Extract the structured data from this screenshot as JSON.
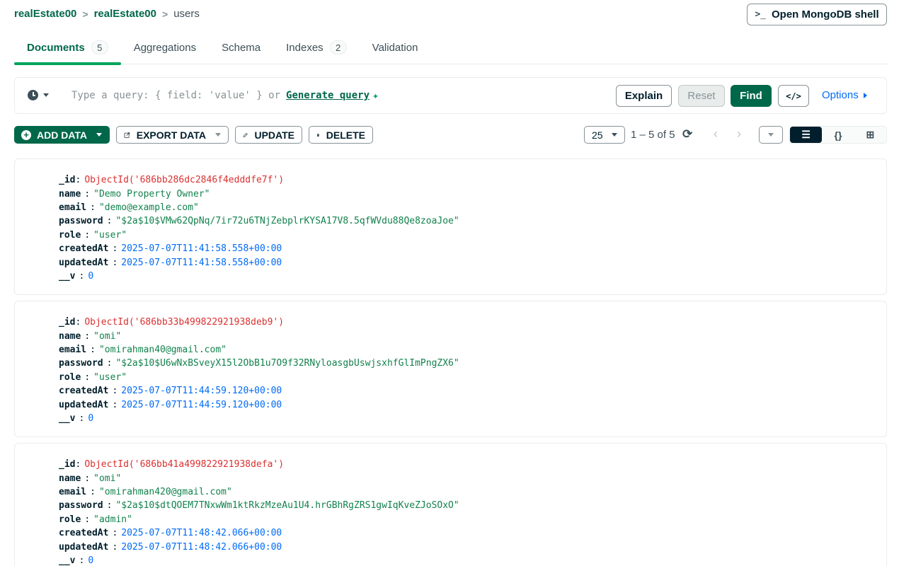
{
  "breadcrumb": {
    "database": "realEstate00",
    "collection_group": "realEstate00",
    "collection": "users",
    "separator": ">"
  },
  "shell_button": {
    "prompt": ">_",
    "label": "Open MongoDB shell"
  },
  "tabs": [
    {
      "label": "Documents",
      "count": "5",
      "active": true
    },
    {
      "label": "Aggregations",
      "count": ""
    },
    {
      "label": "Schema",
      "count": ""
    },
    {
      "label": "Indexes",
      "count": "2"
    },
    {
      "label": "Validation",
      "count": ""
    }
  ],
  "query": {
    "placeholder": "Type a query: { field: 'value' } or",
    "generate_label": "Generate query",
    "explain_label": "Explain",
    "reset_label": "Reset",
    "find_label": "Find",
    "code_label": "</>",
    "options_label": "Options"
  },
  "toolbar": {
    "add_data_label": "ADD DATA",
    "export_data_label": "EXPORT DATA",
    "update_label": "UPDATE",
    "delete_label": "DELETE",
    "page_size": "25",
    "range_text": "1 – 5 of 5",
    "views": {
      "list": "☰",
      "json": "{}",
      "table": "⊞"
    }
  },
  "documents": [
    {
      "_id": "ObjectId('686bb286dc2846f4edddfe7f')",
      "name": "\"Demo Property Owner\"",
      "email": "\"demo@example.com\"",
      "password": "\"$2a$10$VMw62QpNq/7ir72u6TNjZebplrKYSA17V8.5qfWVdu88Qe8zoaJoe\"",
      "role": "\"user\"",
      "createdAt": "2025-07-07T11:41:58.558+00:00",
      "updatedAt": "2025-07-07T11:41:58.558+00:00",
      "__v": "0"
    },
    {
      "_id": "ObjectId('686bb33b499822921938deb9')",
      "name": "\"omi\"",
      "email": "\"omirahman40@gmail.com\"",
      "password": "\"$2a$10$U6wNxBSveyX15l2ObB1u7O9f32RNyloasgbUswjsxhfGlImPngZX6\"",
      "role": "\"user\"",
      "createdAt": "2025-07-07T11:44:59.120+00:00",
      "updatedAt": "2025-07-07T11:44:59.120+00:00",
      "__v": "0"
    },
    {
      "_id": "ObjectId('686bb41a499822921938defa')",
      "name": "\"omi\"",
      "email": "\"omirahman420@gmail.com\"",
      "password": "\"$2a$10$dtQOEM7TNxwWm1ktRkzMzeAu1U4.hrGBhRgZRS1gwIqKveZJoSOxO\"",
      "role": "\"admin\"",
      "createdAt": "2025-07-07T11:48:42.066+00:00",
      "updatedAt": "2025-07-07T11:48:42.066+00:00",
      "__v": "0"
    }
  ],
  "field_keys": {
    "id": "_id",
    "name": "name",
    "email": "email",
    "password": "password",
    "role": "role",
    "createdAt": "createdAt",
    "updatedAt": "updatedAt",
    "v": "__v"
  },
  "colors": {
    "brand": "#00684a",
    "accent_green": "#00a35c",
    "link_blue": "#016bf8",
    "objectid_red": "#db3030",
    "string_green": "#12824d"
  }
}
